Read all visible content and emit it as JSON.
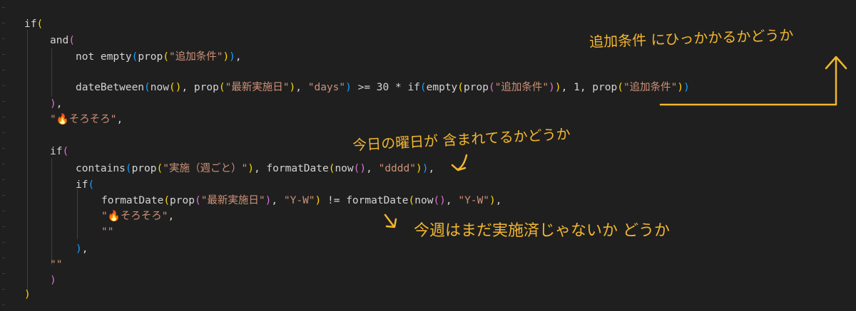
{
  "code": {
    "l1": [
      "if",
      "("
    ],
    "l2": [
      "and",
      "("
    ],
    "l3": [
      "not empty",
      "(",
      "prop",
      "(",
      "\"追加条件\"",
      ")",
      ")",
      ","
    ],
    "l4": [
      "dateBetween",
      "(",
      "now",
      "(",
      ")",
      ", ",
      "prop",
      "(",
      "\"最新実施日\"",
      ")",
      ", ",
      "\"days\"",
      ")",
      " >= 30 * ",
      "if",
      "(",
      "empty",
      "(",
      "prop",
      "(",
      "\"追加条件\"",
      ")",
      ")",
      ", 1, ",
      "prop",
      "(",
      "\"追加条件\"",
      ")",
      ")"
    ],
    "l5": [
      ")",
      ","
    ],
    "l6": [
      "\"🔥そろそろ\"",
      ","
    ],
    "l7": [
      "if",
      "("
    ],
    "l8": [
      "contains",
      "(",
      "prop",
      "(",
      "\"実施（週ごと）\"",
      ")",
      ", ",
      "formatDate",
      "(",
      "now",
      "(",
      ")",
      ", ",
      "\"dddd\"",
      ")",
      ")",
      ","
    ],
    "l9": [
      "if",
      "("
    ],
    "l10": [
      "formatDate",
      "(",
      "prop",
      "(",
      "\"最新実施日\"",
      ")",
      ", ",
      "\"Y-W\"",
      ")",
      " != ",
      "formatDate",
      "(",
      "now",
      "(",
      ")",
      ", ",
      "\"Y-W\"",
      ")",
      ","
    ],
    "l11": [
      "\"🔥そろそろ\"",
      ","
    ],
    "l12": [
      "\"\""
    ],
    "l13": [
      ")",
      ","
    ],
    "l14": [
      "\"\""
    ],
    "l15": [
      ")"
    ],
    "l16": [
      ")"
    ]
  },
  "annotations": {
    "a1": "追加条件 にひっかかるかどうか",
    "a2": "今日の曜日が 含まれてるかどうか",
    "a3": "今週はまだ実施済じゃないか どうか"
  },
  "colors": {
    "background": "#1f1f1f",
    "string": "#ce9178",
    "bracket_level1": "#ffd700",
    "bracket_level2": "#da70d6",
    "bracket_level3": "#179fff",
    "annotation": "#f2b630"
  }
}
